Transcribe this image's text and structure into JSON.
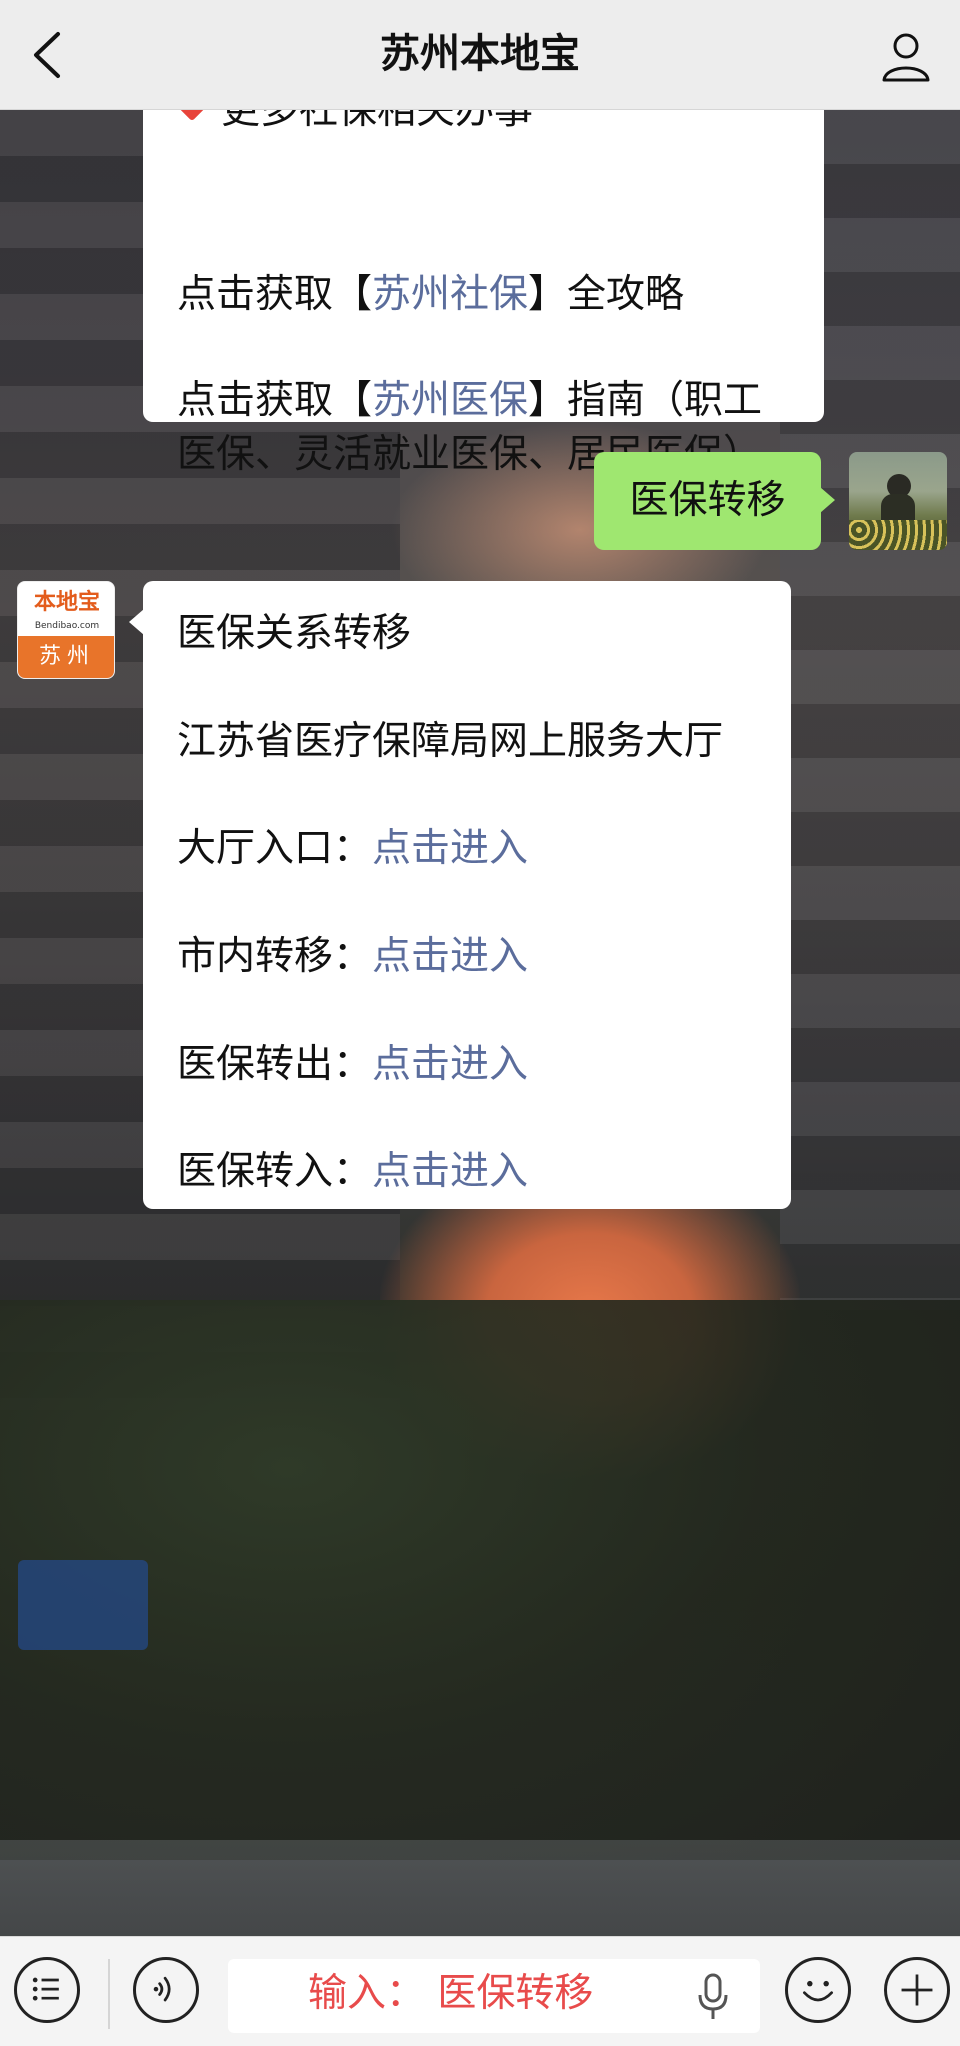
{
  "header": {
    "title": "苏州本地宝"
  },
  "bubble_top": {
    "partial_line": "更多社保相关办事",
    "line1": {
      "prefix": "点击获取【",
      "link": "苏州社保",
      "suffix": "】全攻略"
    },
    "line2": {
      "prefix": "点击获取【",
      "link": "苏州医保",
      "suffix": "】指南（职工"
    },
    "line3": "医保、灵活就业医保、居民医保）"
  },
  "my_message": {
    "text": "医保转移"
  },
  "bot_avatar": {
    "brand": "本地宝",
    "site": "Bendibao.com",
    "city": "苏州"
  },
  "bot_reply": {
    "heading": "医保关系转移",
    "subheading": "江苏省医疗保障局网上服务大厅",
    "items": [
      {
        "label": "大厅入口：",
        "link": "点击进入"
      },
      {
        "label": "市内转移：",
        "link": "点击进入"
      },
      {
        "label": "医保转出：",
        "link": "点击进入"
      },
      {
        "label": "医保转入：",
        "link": "点击进入"
      }
    ]
  },
  "input_bar": {
    "value": "输入：  医保转移"
  },
  "colors": {
    "link": "#5b6d9c",
    "my_bubble": "#9fe770",
    "input_text": "#e84b4b",
    "header_bg": "#ededed"
  },
  "icons": [
    "back-icon",
    "user-icon",
    "menu-list-icon",
    "voice-icon",
    "mic-icon",
    "emoji-icon",
    "plus-icon"
  ]
}
